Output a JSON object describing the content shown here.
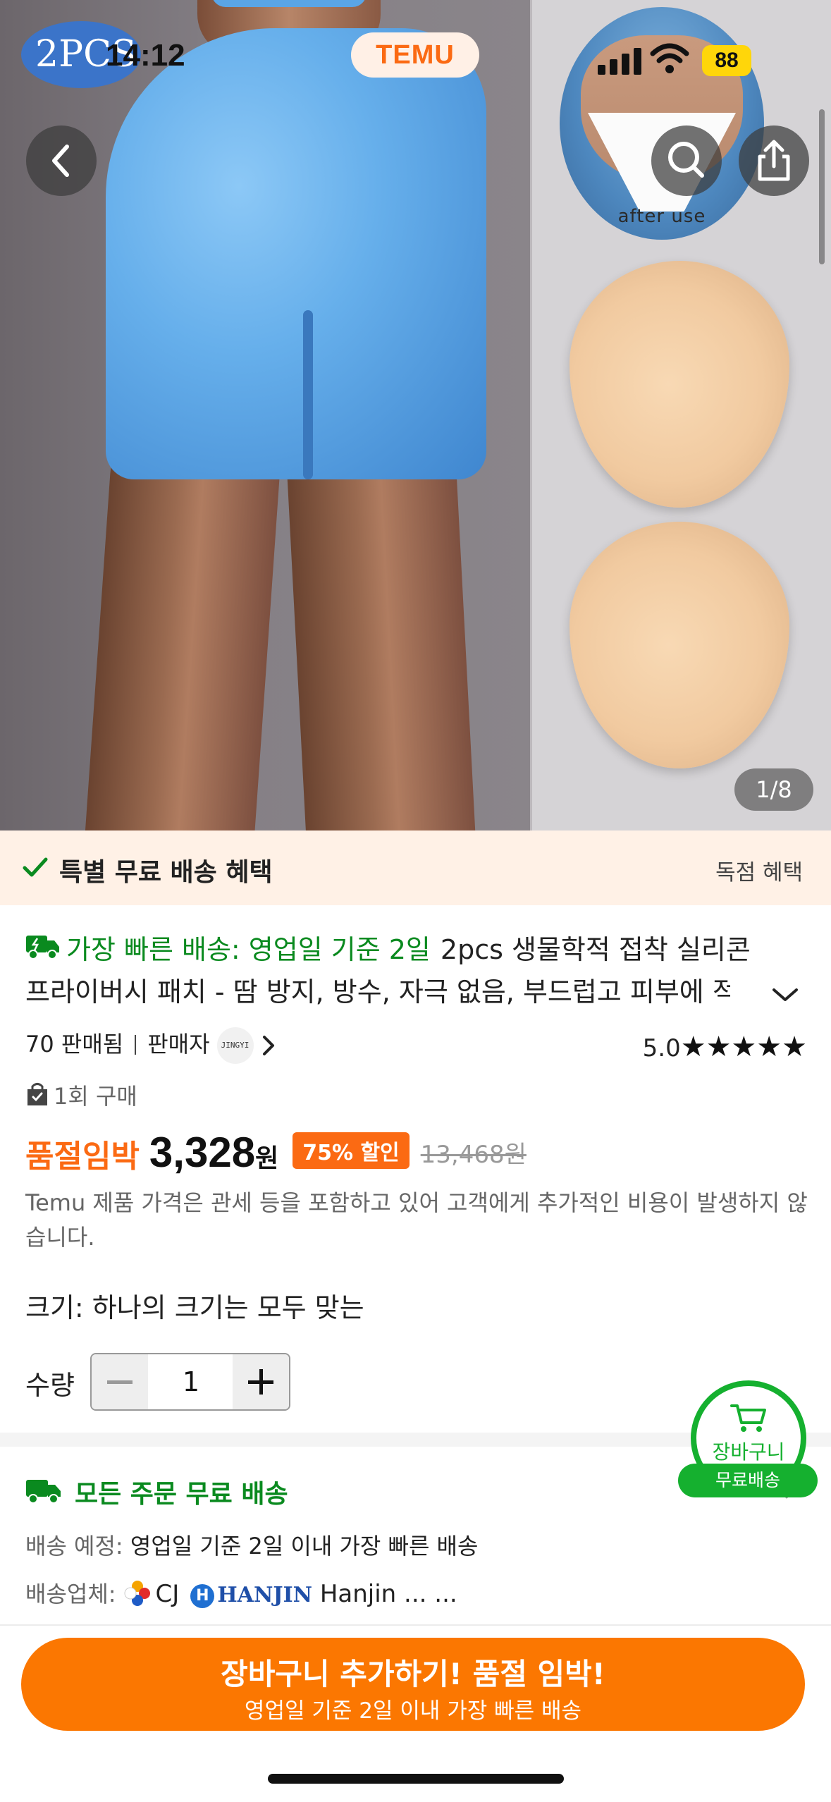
{
  "status_bar": {
    "time": "14:12",
    "battery": "88"
  },
  "brand": {
    "name": "TEMU",
    "accent": "#fb6a13"
  },
  "hero": {
    "badge": "2PCS",
    "after_label": "after use",
    "page_indicator": "1/8"
  },
  "banner": {
    "title": "특별 무료 배송 혜택",
    "right_label": "독점 혜택"
  },
  "product": {
    "fast_delivery": "가장 빠른 배송: 영업일 기준 2일",
    "title_line1": "2pcs 생물학적 접착 실리콘",
    "title_line2": "프라이버시 패치 - 땀 방지, 방수, 자극 없음, 부드럽고 피부에 적",
    "sold_count": "70 판매됨",
    "seller_label": "판매자",
    "seller_logo": "JINGYI",
    "rating_value": "5.0",
    "rating_stars": "★★★★★",
    "purchases": "1회 구매",
    "sellout_label": "품절임박",
    "price": "3,328",
    "price_unit": "원",
    "discount": "75% 할인",
    "original_price": "13,468원",
    "tax_note": "Temu 제품 가격은 관세 등을 포함하고 있어 고객에게 추가적인 비용이 발생하지 않습니다.",
    "size_label": "크기: 하나의 크기는 모두 맞는",
    "quantity_label": "수량",
    "quantity_value": "1"
  },
  "shipping": {
    "title": "모든 주문 무료 배송",
    "eta_label": "배송 예정:",
    "eta_value": "영업일 기준 2일 이내 가장 빠른 배송",
    "carrier_label": "배송업체:",
    "carrier_cj": "CJ",
    "carrier_hanjin_logo": "HANJIN",
    "carrier_hanjin": "Hanjin ...",
    "carrier_more": "..."
  },
  "floating_cart": {
    "label": "장바구니",
    "free_label": "무료배송",
    "color": "#15b02f"
  },
  "cta": {
    "main": "장바구니 추가하기! 품절 임박!",
    "sub": "영업일 기준 2일 이내 가장 빠른 배송",
    "color": "#fb7701"
  },
  "icons": [
    "back-icon",
    "search-icon",
    "share-icon",
    "check-icon",
    "delivery-truck-icon",
    "chevron-down-icon",
    "chevron-right-icon",
    "shopping-bag-icon",
    "cart-icon",
    "cj-logo-icon"
  ]
}
